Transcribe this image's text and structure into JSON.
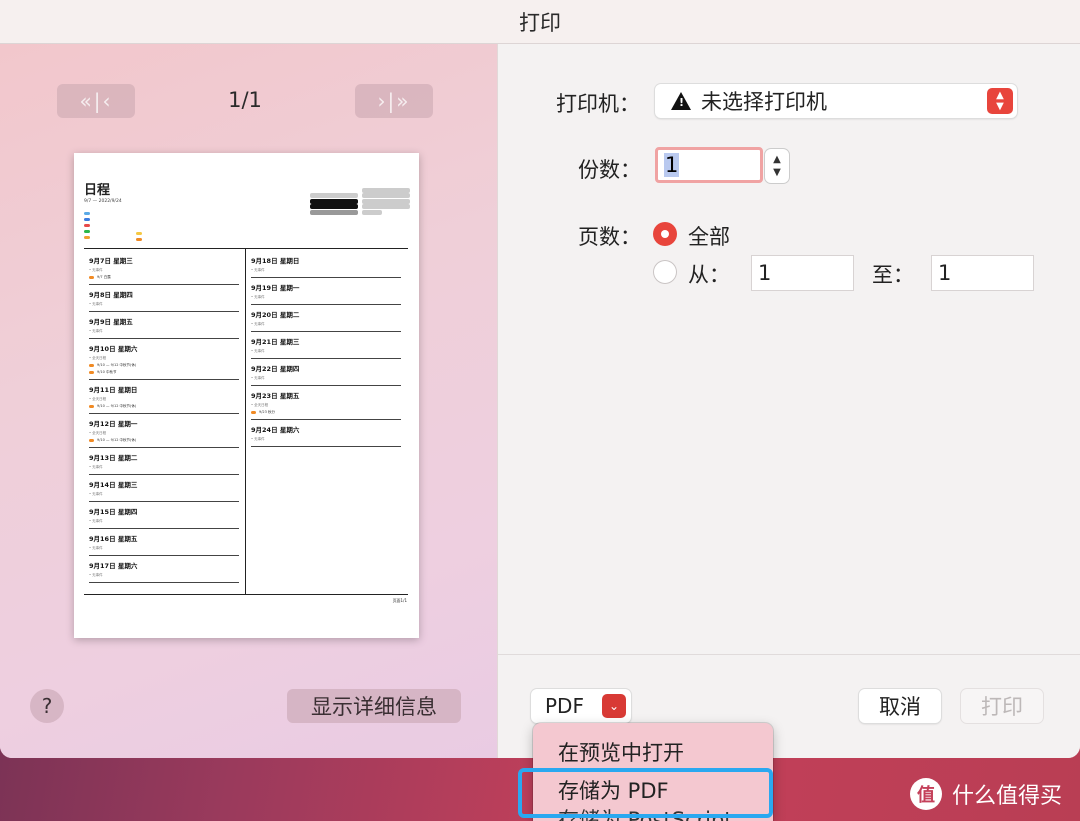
{
  "window": {
    "title": "打印"
  },
  "preview": {
    "prev_label": "«|‹",
    "next_label": "›|»",
    "page_indicator": "1/1",
    "doc_title": "日程",
    "doc_range": "9/7 — 2022/9/24",
    "left_days": [
      {
        "date": "9月7日 星期三",
        "sub": "• 无事件",
        "events": [
          "9/7 白露"
        ]
      },
      {
        "date": "9月8日 星期四",
        "sub": "• 无事件",
        "events": []
      },
      {
        "date": "9月9日 星期五",
        "sub": "• 无事件",
        "events": []
      },
      {
        "date": "9月10日 星期六",
        "sub": "• 全天日程",
        "events": [
          "9/10 — 9/12 中秋节(休)",
          "9/10 中秋节"
        ]
      },
      {
        "date": "9月11日 星期日",
        "sub": "• 全天日程",
        "events": [
          "9/10 — 9/12 中秋节(休)"
        ]
      },
      {
        "date": "9月12日 星期一",
        "sub": "• 全天日程",
        "events": [
          "9/10 — 9/12 中秋节(休)"
        ]
      },
      {
        "date": "9月13日 星期二",
        "sub": "• 无事件",
        "events": []
      },
      {
        "date": "9月14日 星期三",
        "sub": "• 无事件",
        "events": []
      },
      {
        "date": "9月15日 星期四",
        "sub": "• 无事件",
        "events": []
      },
      {
        "date": "9月16日 星期五",
        "sub": "• 无事件",
        "events": []
      },
      {
        "date": "9月17日 星期六",
        "sub": "• 无事件",
        "events": []
      }
    ],
    "right_days": [
      {
        "date": "9月18日 星期日",
        "sub": "• 无事件",
        "events": []
      },
      {
        "date": "9月19日 星期一",
        "sub": "• 无事件",
        "events": []
      },
      {
        "date": "9月20日 星期二",
        "sub": "• 无事件",
        "events": []
      },
      {
        "date": "9月21日 星期三",
        "sub": "• 无事件",
        "events": []
      },
      {
        "date": "9月22日 星期四",
        "sub": "• 无事件",
        "events": []
      },
      {
        "date": "9月23日 星期五",
        "sub": "• 全天日程",
        "events": [
          "9/23 秋分"
        ]
      },
      {
        "date": "9月24日 星期六",
        "sub": "• 无事件",
        "events": []
      }
    ],
    "footer": "页面1/1"
  },
  "left_buttons": {
    "help": "?",
    "details": "显示详细信息"
  },
  "settings": {
    "printer_label": "打印机：",
    "printer_value": "未选择打印机",
    "copies_label": "份数：",
    "copies_value": "1",
    "pages_label": "页数：",
    "all_label": "全部",
    "from_label": "从：",
    "from_value": "1",
    "to_label": "至：",
    "to_value": "1"
  },
  "bottom_buttons": {
    "pdf": "PDF",
    "cancel": "取消",
    "print": "打印"
  },
  "pdf_menu": {
    "items": [
      "在预览中打开",
      "存储为 PDF",
      "存储为 PostScript"
    ]
  },
  "watermark": {
    "text": "什么值得买",
    "icon": "值"
  },
  "colors": {
    "accent": "#e8453c",
    "highlight": "#2aa8f0",
    "event": "#f08a24"
  }
}
